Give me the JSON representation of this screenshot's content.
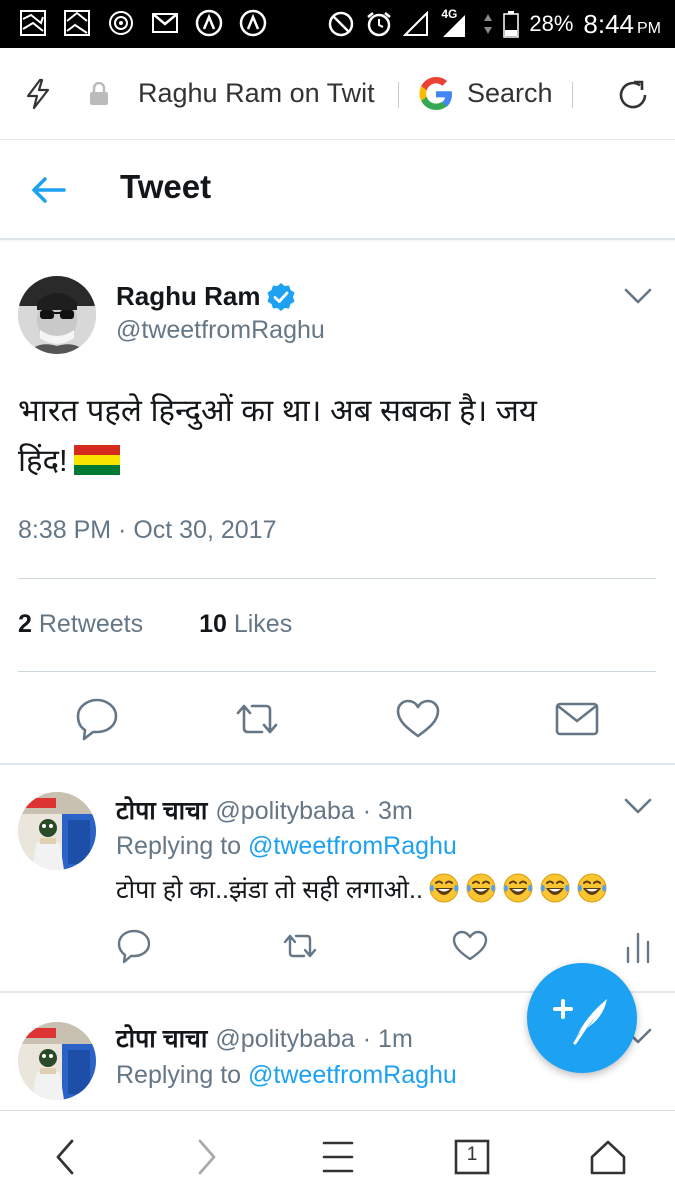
{
  "status_bar": {
    "network": "4G",
    "battery": "28%",
    "time": "8:44",
    "ampm": "PM"
  },
  "browser": {
    "url_text": "Raghu Ram on Twit",
    "search_label": "Search"
  },
  "header": {
    "title": "Tweet"
  },
  "tweet": {
    "author_name": "Raghu Ram",
    "author_handle": "@tweetfromRaghu",
    "text_line1": "भारत पहले हिन्दुओं का था। अब सबका है। जय",
    "text_line2": "हिंद!",
    "timestamp": "8:38 PM · Oct 30, 2017",
    "retweets_count": "2",
    "retweets_label": "Retweets",
    "likes_count": "10",
    "likes_label": "Likes"
  },
  "replies": [
    {
      "name": "टोपा चाचा",
      "handle": "@politybaba",
      "age": "· 3m",
      "replying_prefix": "Replying to",
      "replying_to": "@tweetfromRaghu",
      "text": "टोपा हो का..झंडा तो सही लगाओ..",
      "emoji_count": 5
    },
    {
      "name": "टोपा चाचा",
      "handle": "@politybaba",
      "age": "· 1m",
      "replying_prefix": "Replying to",
      "replying_to": "@tweetfromRaghu"
    }
  ],
  "bottom_nav": {
    "tab_count": "1"
  },
  "colors": {
    "accent": "#1da1f2",
    "muted": "#657786",
    "text": "#14171a"
  }
}
